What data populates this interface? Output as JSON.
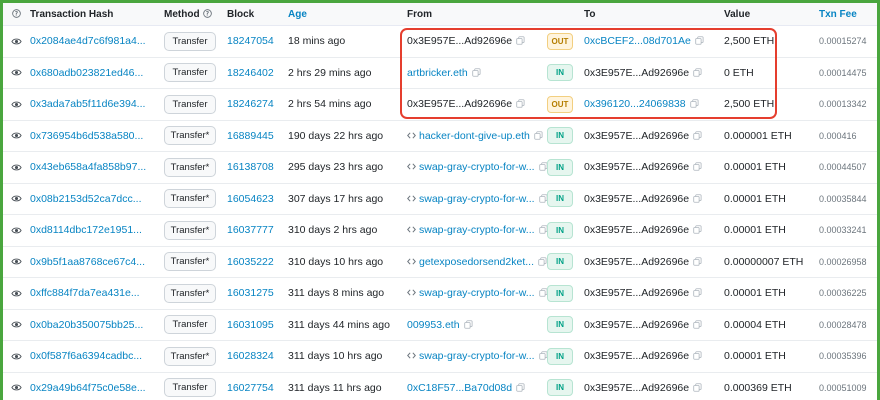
{
  "headers": {
    "eye": "",
    "hash": "Transaction Hash",
    "method": "Method",
    "block": "Block",
    "age": "Age",
    "from": "From",
    "to": "To",
    "value": "Value",
    "fee": "Txn Fee"
  },
  "icons": {
    "eye": "eye-icon",
    "help": "question-circle-icon",
    "copy": "copy-icon",
    "contract": "contract-code-icon"
  },
  "colors": {
    "link": "#0784c3",
    "out_badge": "#b47d00",
    "in_badge": "#00a186",
    "highlight_border": "#e53e2e",
    "frame": "#4aa63e"
  },
  "rows": [
    {
      "hash": "0x2084ae4d7c6f981a4...",
      "method": "Transfer",
      "block": "18247054",
      "age": "18 mins ago",
      "from": "0x3E957E...Ad92696e",
      "from_link": false,
      "from_contract": false,
      "dir": "OUT",
      "to": "0xcBCEF2...08d701Ae",
      "to_link": true,
      "to_contract": false,
      "value": "2,500 ETH",
      "fee": "0.00015274"
    },
    {
      "hash": "0x680adb023821ed46...",
      "method": "Transfer",
      "block": "18246402",
      "age": "2 hrs 29 mins ago",
      "from": "artbricker.eth",
      "from_link": true,
      "from_contract": false,
      "dir": "IN",
      "to": "0x3E957E...Ad92696e",
      "to_link": false,
      "to_contract": false,
      "value": "0 ETH",
      "fee": "0.00014475"
    },
    {
      "hash": "0x3ada7ab5f11d6e394...",
      "method": "Transfer",
      "block": "18246274",
      "age": "2 hrs 54 mins ago",
      "from": "0x3E957E...Ad92696e",
      "from_link": false,
      "from_contract": false,
      "dir": "OUT",
      "to": "0x396120...24069838",
      "to_link": true,
      "to_contract": false,
      "value": "2,500 ETH",
      "fee": "0.00013342"
    },
    {
      "hash": "0x736954b6d538a580...",
      "method": "Transfer*",
      "block": "16889445",
      "age": "190 days 22 hrs ago",
      "from": "hacker-dont-give-up.eth",
      "from_link": true,
      "from_contract": true,
      "dir": "IN",
      "to": "0x3E957E...Ad92696e",
      "to_link": false,
      "to_contract": false,
      "value": "0.000001 ETH",
      "fee": "0.000416"
    },
    {
      "hash": "0x43eb658a4fa858b97...",
      "method": "Transfer*",
      "block": "16138708",
      "age": "295 days 23 hrs ago",
      "from": "swap-gray-crypto-for-w...",
      "from_link": true,
      "from_contract": true,
      "dir": "IN",
      "to": "0x3E957E...Ad92696e",
      "to_link": false,
      "to_contract": false,
      "value": "0.00001 ETH",
      "fee": "0.00044507"
    },
    {
      "hash": "0x08b2153d52ca7dcc...",
      "method": "Transfer*",
      "block": "16054623",
      "age": "307 days 17 hrs ago",
      "from": "swap-gray-crypto-for-w...",
      "from_link": true,
      "from_contract": true,
      "dir": "IN",
      "to": "0x3E957E...Ad92696e",
      "to_link": false,
      "to_contract": false,
      "value": "0.00001 ETH",
      "fee": "0.00035844"
    },
    {
      "hash": "0xd8114dbc172e1951...",
      "method": "Transfer*",
      "block": "16037777",
      "age": "310 days 2 hrs ago",
      "from": "swap-gray-crypto-for-w...",
      "from_link": true,
      "from_contract": true,
      "dir": "IN",
      "to": "0x3E957E...Ad92696e",
      "to_link": false,
      "to_contract": false,
      "value": "0.00001 ETH",
      "fee": "0.00033241"
    },
    {
      "hash": "0x9b5f1aa8768ce67c4...",
      "method": "Transfer*",
      "block": "16035222",
      "age": "310 days 10 hrs ago",
      "from": "getexposedorsend2ket...",
      "from_link": true,
      "from_contract": true,
      "dir": "IN",
      "to": "0x3E957E...Ad92696e",
      "to_link": false,
      "to_contract": false,
      "value": "0.00000007 ETH",
      "fee": "0.00026958"
    },
    {
      "hash": "0xffc884f7da7ea431e...",
      "method": "Transfer*",
      "block": "16031275",
      "age": "311 days 8 mins ago",
      "from": "swap-gray-crypto-for-w...",
      "from_link": true,
      "from_contract": true,
      "dir": "IN",
      "to": "0x3E957E...Ad92696e",
      "to_link": false,
      "to_contract": false,
      "value": "0.00001 ETH",
      "fee": "0.00036225"
    },
    {
      "hash": "0x0ba20b350075bb25...",
      "method": "Transfer",
      "block": "16031095",
      "age": "311 days 44 mins ago",
      "from": "009953.eth",
      "from_link": true,
      "from_contract": false,
      "dir": "IN",
      "to": "0x3E957E...Ad92696e",
      "to_link": false,
      "to_contract": false,
      "value": "0.00004 ETH",
      "fee": "0.00028478"
    },
    {
      "hash": "0x0f587f6a6394cadbc...",
      "method": "Transfer*",
      "block": "16028324",
      "age": "311 days 10 hrs ago",
      "from": "swap-gray-crypto-for-w...",
      "from_link": true,
      "from_contract": true,
      "dir": "IN",
      "to": "0x3E957E...Ad92696e",
      "to_link": false,
      "to_contract": false,
      "value": "0.00001 ETH",
      "fee": "0.00035396"
    },
    {
      "hash": "0x29a49b64f75c0e58e...",
      "method": "Transfer",
      "block": "16027754",
      "age": "311 days 11 hrs ago",
      "from": "0xC18F57...Ba70d08d",
      "from_link": true,
      "from_contract": false,
      "dir": "IN",
      "to": "0x3E957E...Ad92696e",
      "to_link": false,
      "to_contract": false,
      "value": "0.000369 ETH",
      "fee": "0.00051009"
    }
  ]
}
